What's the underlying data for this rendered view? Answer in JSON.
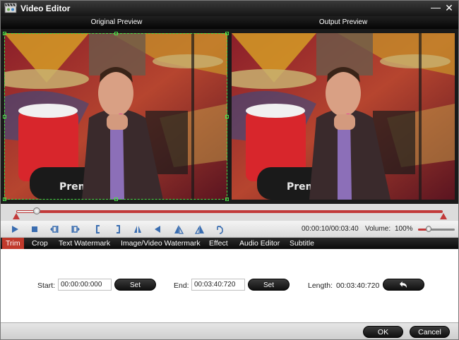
{
  "window": {
    "title": "Video Editor",
    "minimize_glyph": "—",
    "close_glyph": "✕",
    "icon": "film-clapper-icon"
  },
  "preview": {
    "original_label": "Original Preview",
    "output_label": "Output Preview"
  },
  "timeline": {
    "progress_fraction": 0.048
  },
  "controls": {
    "buttons": [
      {
        "name": "play-icon"
      },
      {
        "name": "stop-icon"
      },
      {
        "name": "previous-frame-icon"
      },
      {
        "name": "next-frame-icon"
      },
      {
        "name": "set-start-bracket-icon"
      },
      {
        "name": "set-end-bracket-icon"
      },
      {
        "name": "flip-horizontal-icon"
      },
      {
        "name": "flip-vertical-icon"
      },
      {
        "name": "rotate-left-icon"
      },
      {
        "name": "rotate-right-icon"
      },
      {
        "name": "undo-rotate-icon"
      }
    ],
    "time": "00:00:10/00:03:40",
    "volume_label": "Volume:",
    "volume_value": "100%",
    "volume_fraction": 0.28
  },
  "tabs": [
    {
      "label": "Trim",
      "active": true
    },
    {
      "label": "Crop",
      "active": false
    },
    {
      "label": "Text Watermark",
      "active": false
    },
    {
      "label": "Image/Video Watermark",
      "active": false
    },
    {
      "label": "Effect",
      "active": false
    },
    {
      "label": "Audio Editor",
      "active": false
    },
    {
      "label": "Subtitle",
      "active": false
    }
  ],
  "trim": {
    "start_label": "Start:",
    "start_value": "00:00:00:000",
    "set_start_label": "Set",
    "end_label": "End:",
    "end_value": "00:03:40:720",
    "set_end_label": "Set",
    "length_label": "Length:",
    "length_value": "00:03:40:720",
    "reset_icon": "undo-arrow-icon"
  },
  "footer": {
    "ok_label": "OK",
    "cancel_label": "Cancel"
  },
  "colors": {
    "accent": "#c0392b",
    "titlebar": "#1c1c1c",
    "crop_guide": "#49e049"
  }
}
